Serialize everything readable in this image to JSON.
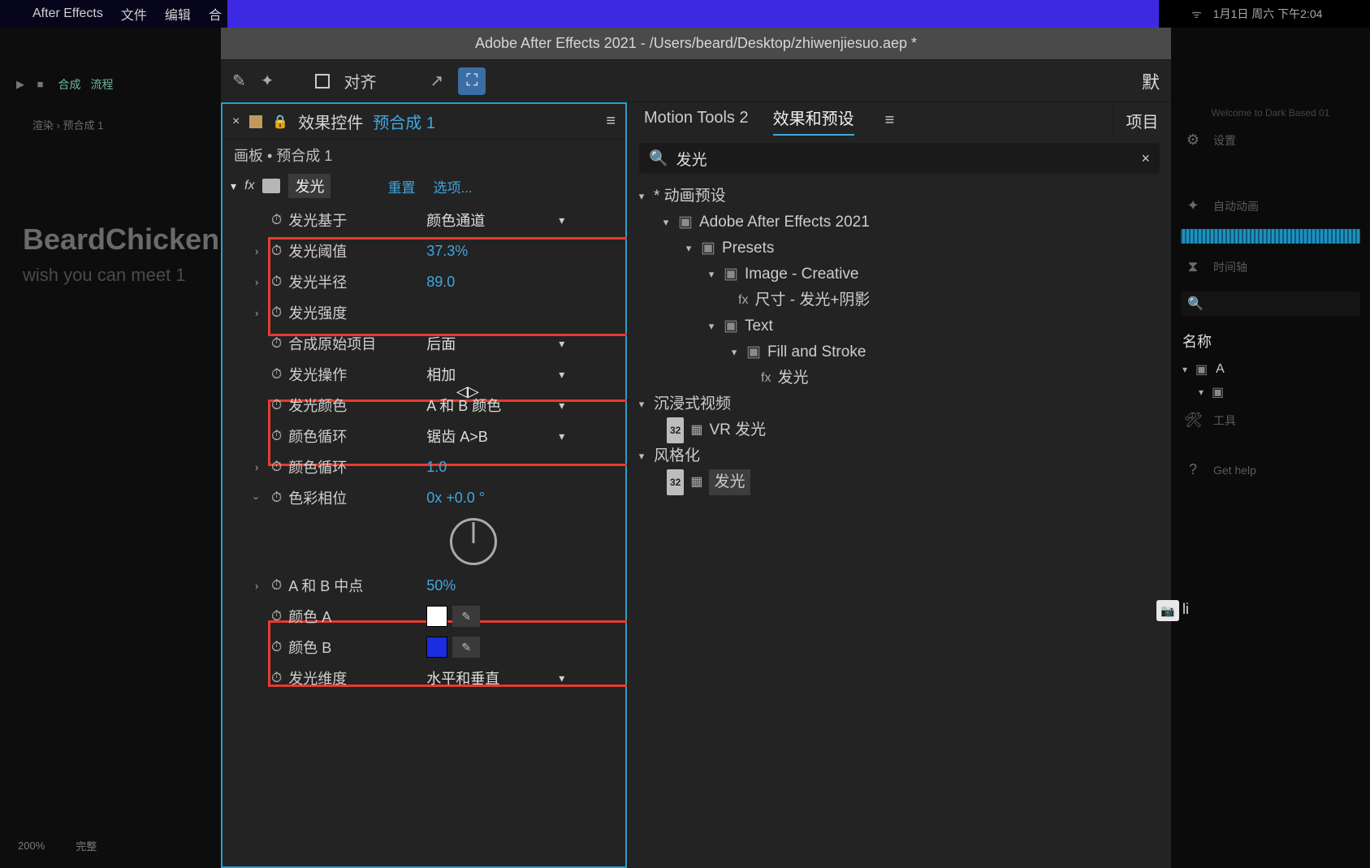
{
  "menubar": {
    "app": "After Effects",
    "file": "文件",
    "edit": "编辑",
    "comp": "合"
  },
  "clock": {
    "wifi": "⌔",
    "date": "1月1日 周六 下午2:04"
  },
  "left": {
    "tabs_icons": "▶ ■",
    "tabs_label1": "合成",
    "tabs_label2": "流程",
    "crumb": "渲染   ›   预合成 1",
    "watermark1": "BeardChicken",
    "watermark2": "wish you can meet 1",
    "foot_zoom": "200%",
    "foot_mode": "完整"
  },
  "title": "Adobe After Effects 2021 - /Users/beard/Desktop/zhiwenjiesuo.aep *",
  "toolbar": {
    "align": "对齐"
  },
  "effects_panel": {
    "title": "效果控件",
    "link": "预合成 1",
    "sub": "画板 • 预合成 1",
    "fx_name": "发光",
    "reset": "重置",
    "options": "选项...",
    "props": {
      "glow_base_label": "发光基于",
      "glow_base_value": "颜色通道",
      "threshold_label": "发光阈值",
      "threshold_value": "37.3%",
      "radius_label": "发光半径",
      "radius_value": "89.0",
      "intensity_label": "发光强度",
      "intensity_value": "",
      "composite_label": "合成原始项目",
      "composite_value": "后面",
      "operation_label": "发光操作",
      "operation_value": "相加",
      "colors_label": "发光颜色",
      "colors_value": "A 和 B 颜色",
      "loop_label": "颜色循环",
      "loop_value": "锯齿 A>B",
      "loops_label": "颜色循环",
      "loops_value": "1.0",
      "phase_label": "色彩相位",
      "phase_value": "0x +0.0 °",
      "midpoint_label": "A 和 B 中点",
      "midpoint_value": "50%",
      "colorA_label": "颜色 A",
      "colorA_hex": "#ffffff",
      "colorB_label": "颜色 B",
      "colorB_hex": "#1a2ee0",
      "dimensions_label": "发光维度",
      "dimensions_value": "水平和垂直"
    }
  },
  "presets_panel": {
    "tab_motion": "Motion Tools 2",
    "tab_presets": "效果和预设",
    "search_value": "发光",
    "tree": {
      "anim_presets": "* 动画预设",
      "ae": "Adobe After Effects 2021",
      "presets": "Presets",
      "image_creative": "Image - Creative",
      "size_glow_shadow": "尺寸 - 发光+阴影",
      "text": "Text",
      "fill_stroke": "Fill and Stroke",
      "glow_preset": "发光",
      "immersive": "沉浸式视频",
      "vr_glow": "VR 发光",
      "stylize": "风格化",
      "glow_fx": "发光"
    },
    "project_tab": "项目"
  },
  "right": {
    "welcome": "Welcome to Dark Based 01",
    "items": {
      "settings": "设置",
      "auto": "自动动画",
      "timeline": "时间轴",
      "tools": "工具",
      "help": "Get help"
    },
    "name_header": "名称",
    "row_a": "A",
    "li_label": "li"
  }
}
